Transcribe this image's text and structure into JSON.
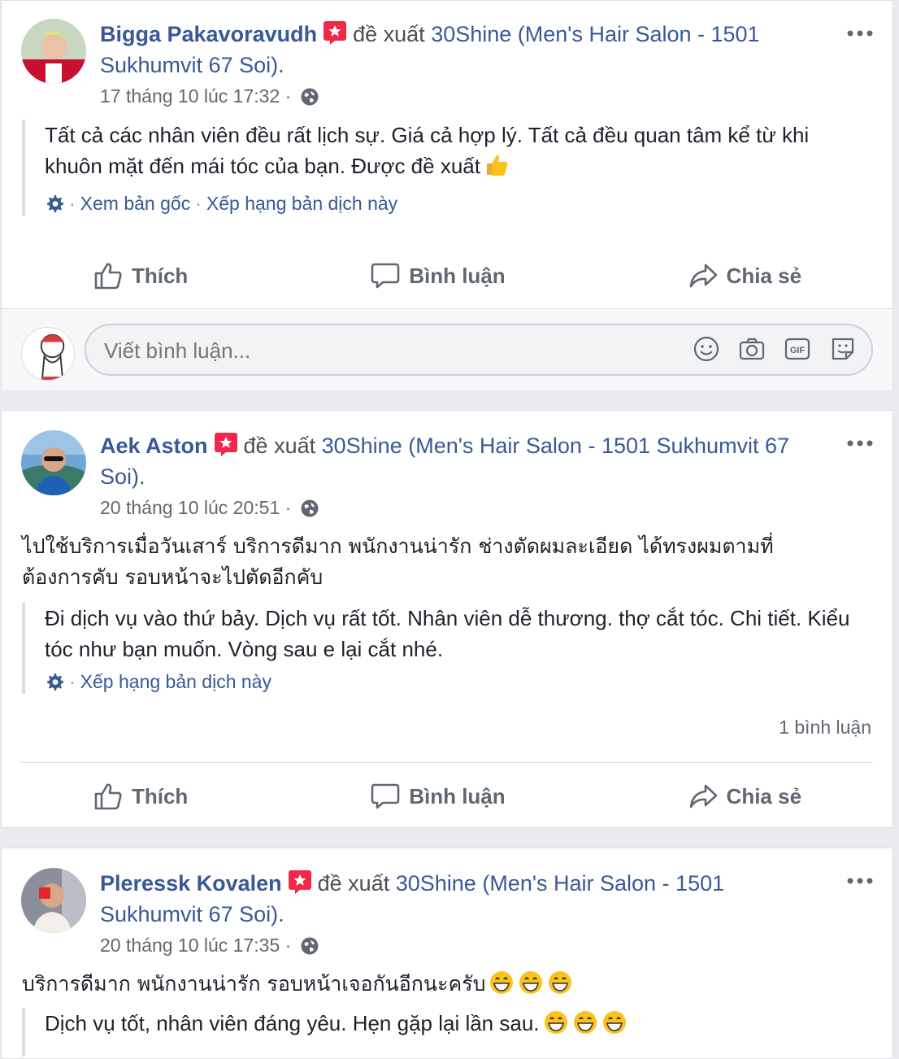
{
  "posts": [
    {
      "author": "Bigga Pakavoravudh",
      "verb": "đề xuất",
      "page": "30Shine (Men's Hair Salon - 1501 Sukhumvit 67 Soi)",
      "period": ".",
      "timestamp": "17 tháng 10 lúc 17:32",
      "dot": "·",
      "original_text": "",
      "translation": "Tất cả các nhân viên đều rất lịch sự. Giá cả hợp lý. Tất cả đều quan tâm kể từ khi khuôn mặt đến mái tóc của bạn. Được đề xuất",
      "translation_emoji": "thumbs-up",
      "see_original": "Xem bản gốc",
      "rate_translation": "Xếp hạng bản dịch này"
    },
    {
      "author": "Aek Aston",
      "verb": "đề xuất",
      "page": "30Shine (Men's Hair Salon - 1501 Sukhumvit 67 Soi)",
      "period": ".",
      "timestamp": "20 tháng 10 lúc 20:51",
      "dot": "·",
      "original_text": "ไปใช้บริการเมื่อวันเสาร์ บริการดีมาก พนักงานน่ารัก ช่างตัดผมละเอียด ได้ทรงผมตามที่ต้องการคับ รอบหน้าจะไปตัดอีกคับ",
      "translation": "Đi dịch vụ vào thứ bảy. Dịch vụ rất tốt. Nhân viên dễ thương. thợ cắt tóc. Chi tiết. Kiểu tóc như bạn muốn. Vòng sau e lại cắt nhé.",
      "rate_translation": "Xếp hạng bản dịch này",
      "comment_count": "1 bình luận"
    },
    {
      "author": "Pleressk Kovalen",
      "verb": "đề xuất",
      "page": "30Shine (Men's Hair Salon - 1501 Sukhumvit 67 Soi)",
      "period": ".",
      "timestamp": "20 tháng 10 lúc 17:35",
      "dot": "·",
      "original_text": "บริการดีมาก พนักงานน่ารัก รอบหน้าเจอกันอีกนะครับ",
      "translation": "Dịch vụ tốt, nhân viên đáng yêu. Hẹn gặp lại lần sau."
    }
  ],
  "actions": {
    "like": "Thích",
    "comment": "Bình luận",
    "share": "Chia sẻ"
  },
  "comment_input": {
    "placeholder": "Viết bình luận..."
  },
  "colors": {
    "link": "#385898",
    "muted": "#616770",
    "border": "#dadde1",
    "background": "#e9ebee"
  }
}
